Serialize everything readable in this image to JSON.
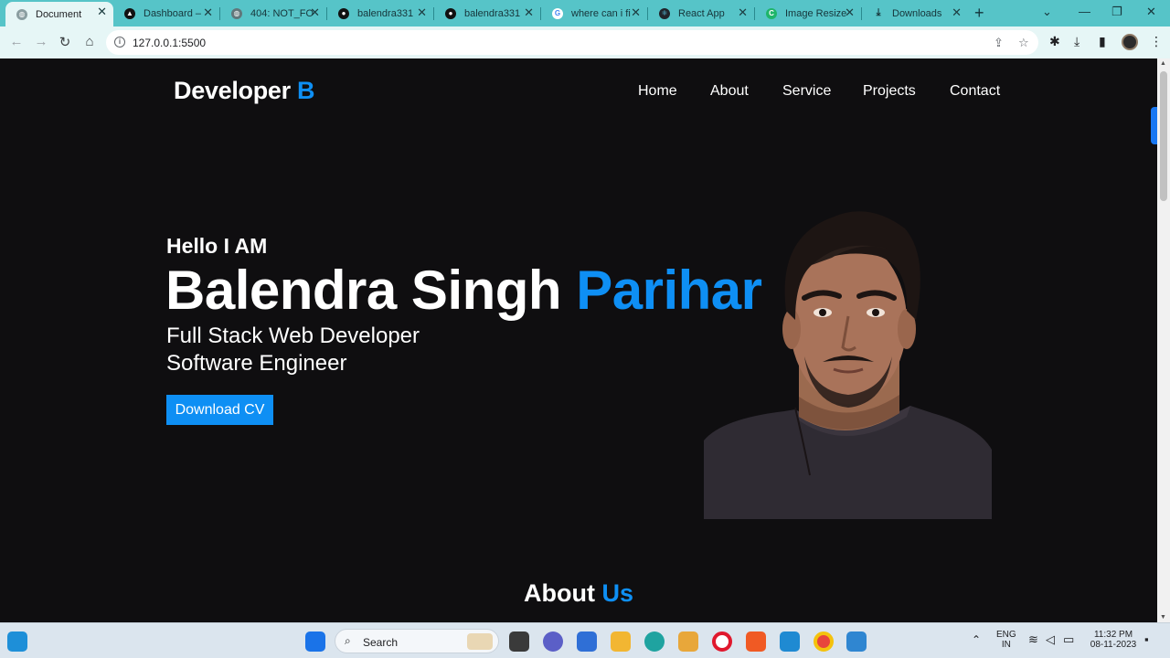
{
  "browser": {
    "tabs": [
      {
        "title": "Document",
        "favicon": "globe-icon",
        "active": true
      },
      {
        "title": "Dashboard –",
        "favicon": "triangle-logo-icon",
        "active": false
      },
      {
        "title": "404: NOT_FO",
        "favicon": "globe-icon",
        "active": false
      },
      {
        "title": "balendra331",
        "favicon": "github-icon",
        "active": false
      },
      {
        "title": "balendra331",
        "favicon": "github-icon",
        "active": false
      },
      {
        "title": "where can i fi",
        "favicon": "google-icon",
        "active": false
      },
      {
        "title": "React App",
        "favicon": "react-icon",
        "active": false
      },
      {
        "title": "Image Resize",
        "favicon": "c-logo-icon",
        "active": false
      },
      {
        "title": "Downloads",
        "favicon": "download-icon",
        "active": false
      }
    ],
    "url": "127.0.0.1:5500"
  },
  "site": {
    "brand_main": "Developer",
    "brand_accent": " B",
    "nav": [
      "Home",
      "About",
      "Service",
      "Projects",
      "Contact"
    ],
    "hero": {
      "greeting": "Hello I AM",
      "name_main": "Balendra Singh ",
      "name_accent": "Parihar",
      "roles": [
        "Full Stack Web Developer",
        "Software Engineer"
      ],
      "cta": "Download CV"
    },
    "about_main": "About ",
    "about_accent": "Us"
  },
  "colors": {
    "accent": "#0e8ff4",
    "page_bg": "#0f0e10",
    "chrome": "#56c4c8"
  },
  "taskbar": {
    "search_label": "Search",
    "lang_top": "ENG",
    "lang_bottom": "IN",
    "time": "11:32 PM",
    "date": "08-11-2023"
  }
}
